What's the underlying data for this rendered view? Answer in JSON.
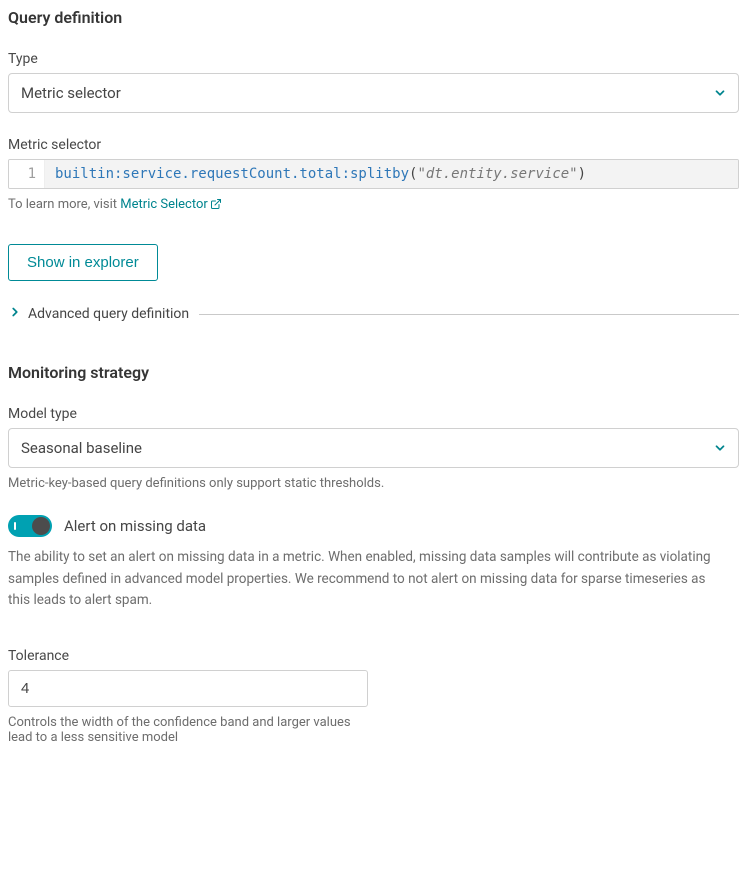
{
  "query": {
    "section_title": "Query definition",
    "type_label": "Type",
    "type_value": "Metric selector",
    "selector_label": "Metric selector",
    "code": {
      "line_no": "1",
      "selector": "builtin:service.requestCount.total:splitby",
      "open_paren": "(",
      "arg": "\"dt.entity.service\"",
      "close_paren": ")"
    },
    "help_prefix": "To learn more, visit ",
    "help_link": "Metric Selector",
    "show_btn": "Show in explorer",
    "advanced_label": "Advanced query definition"
  },
  "strategy": {
    "section_title": "Monitoring strategy",
    "model_type_label": "Model type",
    "model_type_value": "Seasonal baseline",
    "model_note": "Metric-key-based query definitions only support static thresholds.",
    "toggle_label": "Alert on missing data",
    "toggle_on": true,
    "toggle_desc": "The ability to set an alert on missing data in a metric. When enabled, missing data samples will contribute as violating samples defined in advanced model properties. We recommend to not alert on missing data for sparse timeseries as this leads to alert spam.",
    "tolerance_label": "Tolerance",
    "tolerance_value": "4",
    "tolerance_help": "Controls the width of the confidence band and larger values lead to a less sensitive model"
  },
  "colors": {
    "accent": "#00848e"
  }
}
